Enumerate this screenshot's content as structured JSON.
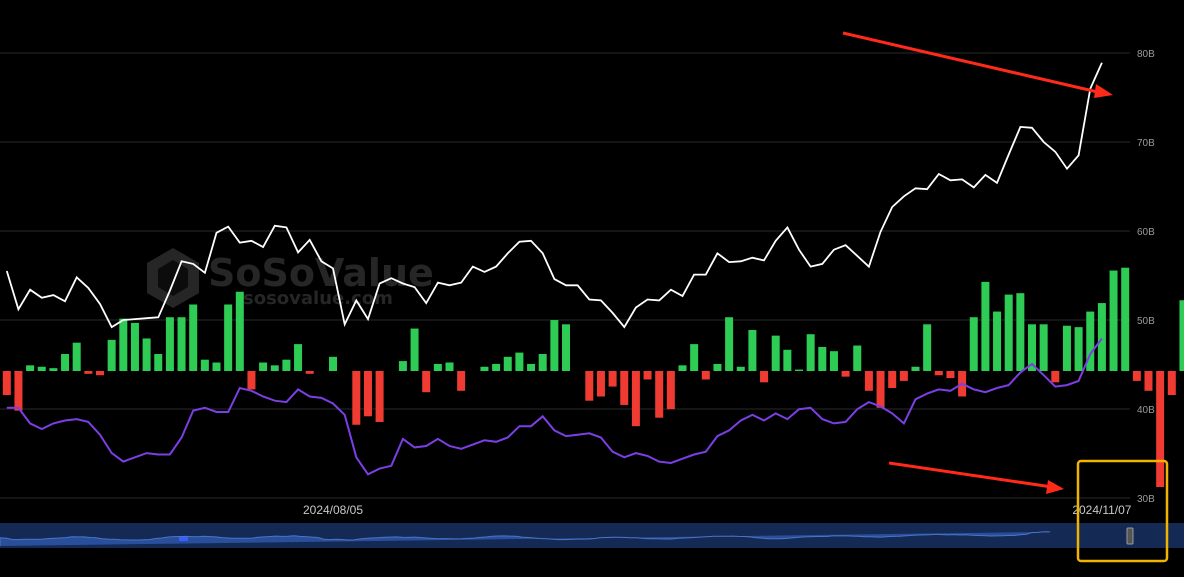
{
  "watermark": {
    "brand": "SoSoValue",
    "site": "sosovalue.com"
  },
  "colors": {
    "background": "#000000",
    "grid": "#2a2a2a",
    "positive": "#2ecc55",
    "negative": "#f03b32",
    "price_line": "#ffffff",
    "secondary_line": "#7b3fe4",
    "navigator_fill": "#1e3a73",
    "annotation_arrow": "#ff2a1a",
    "highlight_box": "#f0b400"
  },
  "chart_data": {
    "type": "bar",
    "title": "",
    "xlabel": "",
    "ylabel": "",
    "grid": true,
    "legend": "none",
    "x_ticks": [
      {
        "label": "2024/08/05",
        "index": 28
      },
      {
        "label": "2024/11/07",
        "index": 94
      }
    ],
    "y_ticks_right": [
      "30B",
      "40B",
      "50B",
      "60B",
      "70B",
      "80B"
    ],
    "ylim_right": [
      30,
      80
    ],
    "series": [
      {
        "type": "bar",
        "values": [
          -1.7,
          -2.8,
          0.4,
          0.3,
          0.2,
          1.2,
          2.0,
          -0.2,
          -0.3,
          2.2,
          3.7,
          3.4,
          2.3,
          1.2,
          3.8,
          3.8,
          4.7,
          0.8,
          0.6,
          4.7,
          5.6,
          -1.3,
          0.6,
          0.4,
          0.8,
          1.9,
          -0.2,
          0,
          1.0,
          0,
          -3.8,
          -3.2,
          -3.6,
          0,
          0.7,
          3.0,
          -1.5,
          0.5,
          0.6,
          -1.4,
          0,
          0.3,
          0.5,
          1.0,
          1.3,
          0.5,
          1.2,
          3.6,
          3.3,
          0,
          -2.1,
          -1.8,
          -1.1,
          -2.4,
          -3.9,
          -0.6,
          -3.3,
          -2.7,
          0.4,
          1.9,
          -0.6,
          0.5,
          3.8,
          0.3,
          2.9,
          -0.8,
          2.5,
          1.5,
          0.1,
          2.6,
          1.7,
          1.4,
          -0.4,
          1.8,
          -1.4,
          -2.6,
          -1.2,
          -0.7,
          0.3,
          3.3,
          -0.3,
          -0.5,
          -1.8,
          3.8,
          6.3,
          4.2,
          5.4,
          5.5,
          3.3,
          3.3,
          -0.8,
          3.2,
          3.1,
          4.2,
          4.8,
          7.1,
          7.3,
          -0.7,
          -1.4,
          -8.2,
          -1.7,
          5.0,
          9.4
        ]
      },
      {
        "type": "line",
        "axis": "right",
        "values": [
          55.5,
          51.2,
          53.4,
          52.5,
          52.8,
          52.1,
          54.8,
          53.6,
          51.8,
          49.2,
          50.0,
          50.1,
          50.2,
          50.3,
          53.3,
          56.6,
          56.3,
          55.3,
          59.8,
          60.5,
          58.7,
          58.9,
          58.2,
          60.6,
          60.4,
          57.6,
          59.0,
          56.6,
          55.8,
          49.5,
          52.2,
          50.1,
          54.1,
          54.7,
          54.1,
          53.7,
          51.9,
          54.2,
          53.9,
          54.2,
          56.0,
          55.4,
          56.0,
          57.5,
          58.8,
          58.9,
          57.5,
          54.6,
          53.9,
          53.9,
          52.3,
          52.2,
          50.8,
          49.2,
          51.4,
          52.3,
          52.2,
          53.4,
          52.7,
          55.1,
          55.1,
          57.5,
          56.5,
          56.6,
          57.0,
          56.7,
          58.9,
          60.4,
          57.9,
          56.0,
          56.3,
          57.9,
          58.4,
          57.2,
          56.0,
          59.9,
          62.7,
          63.9,
          64.8,
          64.7,
          66.4,
          65.7,
          65.8,
          64.9,
          66.3,
          65.4,
          68.6,
          71.7,
          71.6,
          70.0,
          68.9,
          67.0,
          68.5,
          76.0,
          78.9
        ]
      },
      {
        "type": "line",
        "values": [
          -2.6,
          -2.6,
          -3.7,
          -4.1,
          -3.7,
          -3.5,
          -3.4,
          -3.6,
          -4.5,
          -5.8,
          -6.4,
          -6.1,
          -5.8,
          -5.9,
          -5.9,
          -4.7,
          -2.8,
          -2.6,
          -2.9,
          -2.9,
          -1.2,
          -1.4,
          -1.8,
          -2.1,
          -2.2,
          -1.3,
          -1.8,
          -1.9,
          -2.3,
          -3.1,
          -6.1,
          -7.3,
          -6.9,
          -6.7,
          -4.8,
          -5.4,
          -5.3,
          -4.8,
          -5.3,
          -5.5,
          -5.2,
          -4.9,
          -5.0,
          -4.7,
          -3.9,
          -3.9,
          -3.2,
          -4.2,
          -4.6,
          -4.5,
          -4.4,
          -4.7,
          -5.7,
          -6.1,
          -5.8,
          -6.0,
          -6.4,
          -6.5,
          -6.2,
          -5.9,
          -5.7,
          -4.6,
          -4.2,
          -3.5,
          -3.1,
          -3.5,
          -3.0,
          -3.4,
          -2.7,
          -2.6,
          -3.4,
          -3.7,
          -3.6,
          -2.7,
          -2.2,
          -2.5,
          -3.0,
          -3.7,
          -2.0,
          -1.6,
          -1.3,
          -1.4,
          -0.9,
          -1.3,
          -1.5,
          -1.2,
          -1.0,
          -0.1,
          0.5,
          -0.3,
          -1.1,
          -1.0,
          -0.7,
          1.2,
          2.3
        ]
      }
    ]
  }
}
